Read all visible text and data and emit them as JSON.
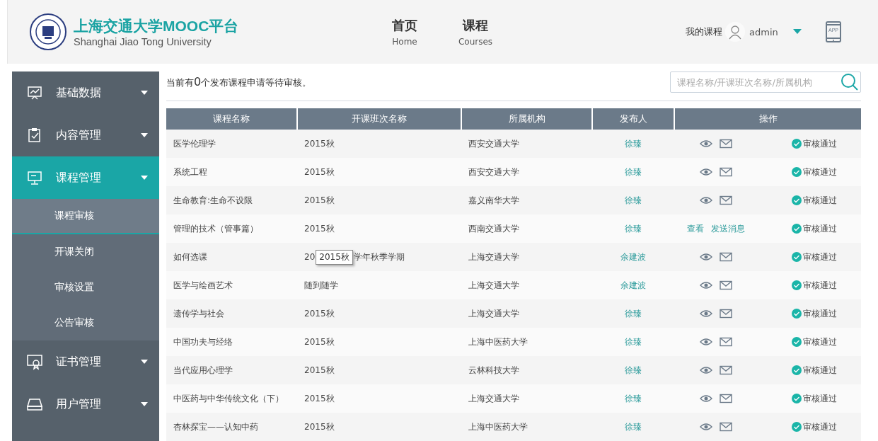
{
  "header": {
    "title": "上海交通大学MOOC平台",
    "subtitle": "Shanghai Jiao Tong University",
    "nav": [
      {
        "label": "首页",
        "sub": "Home"
      },
      {
        "label": "课程",
        "sub": "Courses"
      }
    ],
    "my_courses": "我的课程",
    "user": "admin",
    "app_label": "APP"
  },
  "sidebar": {
    "items": [
      {
        "label": "基础数据",
        "selected": false
      },
      {
        "label": "内容管理",
        "selected": false
      },
      {
        "label": "课程管理",
        "selected": true,
        "children": [
          {
            "label": "课程审核",
            "selected": true
          },
          {
            "label": "开课关闭",
            "selected": false
          },
          {
            "label": "审核设置",
            "selected": false
          },
          {
            "label": "公告审核",
            "selected": false
          }
        ]
      },
      {
        "label": "证书管理",
        "selected": false
      },
      {
        "label": "用户管理",
        "selected": false
      }
    ]
  },
  "notice_parts": [
    "当前有",
    "0",
    "个发布课程申请等待审核。"
  ],
  "search": {
    "placeholder": "课程名称/开课班次名称/所属机构"
  },
  "table": {
    "columns": [
      "课程名称",
      "开课班次名称",
      "所属机构",
      "发布人",
      "操作"
    ],
    "rows": [
      {
        "name": "医学伦理学",
        "class": "2015秋",
        "org": "西安交通大学",
        "publisher": "徐臻",
        "actions": {
          "kind": "icons"
        },
        "status": "审核通过"
      },
      {
        "name": "系统工程",
        "class": "2015秋",
        "org": "西安交通大学",
        "publisher": "徐臻",
        "actions": {
          "kind": "icons"
        },
        "status": "审核通过"
      },
      {
        "name": "生命教育:生命不设限",
        "class": "2015秋",
        "org": "嘉义南华大学",
        "publisher": "徐臻",
        "actions": {
          "kind": "icons"
        },
        "status": "审核通过"
      },
      {
        "name": "管理的技术（管事篇）",
        "class": "2015秋",
        "org": "西南交通大学",
        "publisher": "徐臻",
        "actions": {
          "kind": "links",
          "view": "查看",
          "message": "发送消息"
        },
        "status": "审核通过"
      },
      {
        "name": "如何选课",
        "class": "20",
        "class_after_tooltip": "学年秋季学期",
        "tooltip": "2015秋",
        "org": "上海交通大学",
        "publisher": "余建波",
        "actions": {
          "kind": "icons"
        },
        "status": "审核通过"
      },
      {
        "name": "医学与绘画艺术",
        "class": "随到随学",
        "org": "上海交通大学",
        "publisher": "余建波",
        "actions": {
          "kind": "icons"
        },
        "status": "审核通过"
      },
      {
        "name": "遗传学与社会",
        "class": "2015秋",
        "org": "上海交通大学",
        "publisher": "徐臻",
        "actions": {
          "kind": "icons"
        },
        "status": "审核通过"
      },
      {
        "name": "中国功夫与经络",
        "class": "2015秋",
        "org": "上海中医药大学",
        "publisher": "徐臻",
        "actions": {
          "kind": "icons"
        },
        "status": "审核通过"
      },
      {
        "name": "当代应用心理学",
        "class": "2015秋",
        "org": "云林科技大学",
        "publisher": "徐臻",
        "actions": {
          "kind": "icons"
        },
        "status": "审核通过"
      },
      {
        "name": "中医药与中华传统文化（下）",
        "class": "2015秋",
        "org": "上海交通大学",
        "publisher": "徐臻",
        "actions": {
          "kind": "icons"
        },
        "status": "审核通过"
      },
      {
        "name": "杏林探宝——认知中药",
        "class": "2015秋",
        "org": "上海中医药大学",
        "publisher": "徐臻",
        "actions": {
          "kind": "icons"
        },
        "status": "审核通过"
      }
    ]
  }
}
